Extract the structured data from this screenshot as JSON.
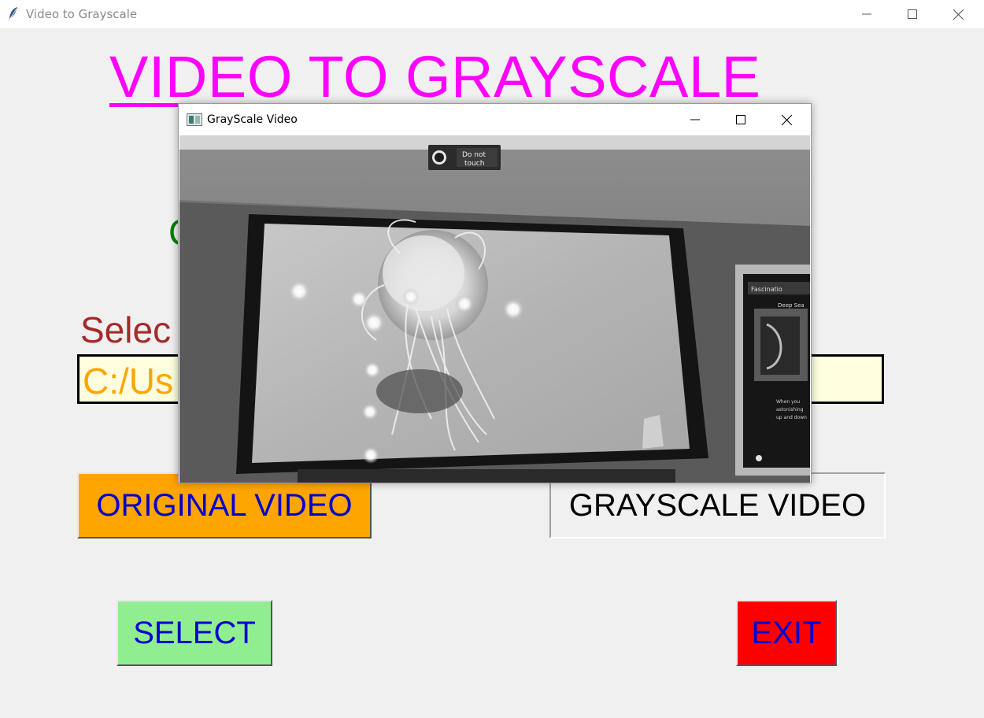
{
  "window": {
    "title": "Video to Grayscale"
  },
  "heading": "VIDEO TO GRAYSCALE",
  "green_text": "C",
  "select_label": "Selec",
  "path_field": {
    "value": "C:/Us"
  },
  "buttons": {
    "original": "ORIGINAL VIDEO",
    "grayscale": "GRAYSCALE VIDEO",
    "select": "SELECT",
    "exit": "EXIT"
  },
  "video_window": {
    "title": "GrayScale Video",
    "sign_text_line1": "Do not",
    "sign_text_line2": "touch",
    "poster_header": "Fascinatio",
    "poster_sub": "Deep Sea",
    "poster_body_1": "When you",
    "poster_body_2": "astonishing",
    "poster_body_3": "up and down"
  },
  "colors": {
    "heading": "#ff00ff",
    "original_button": "#ffa500",
    "select_button": "#90ee90",
    "exit_button": "#ff0000",
    "button_text": "#0000cd",
    "path_field_bg": "#ffffe0",
    "path_text": "#ffa500",
    "label_text": "#a52a2a"
  }
}
